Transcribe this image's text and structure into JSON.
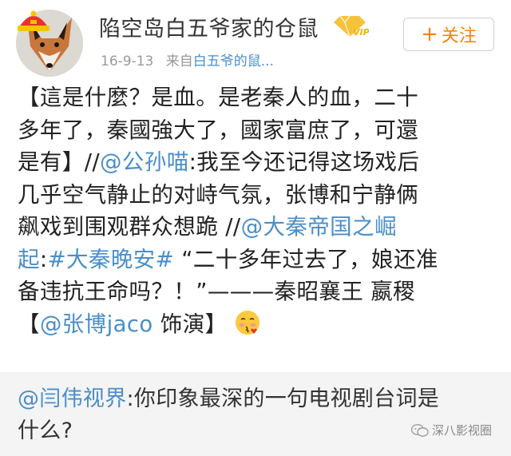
{
  "header": {
    "user_name": "陷空岛白五爷家的仓鼠",
    "vip_badge": "VIP",
    "date": "16-9-13",
    "source_prefix": "来自",
    "source_name": "白五爷的鼠...",
    "follow_label": "关注",
    "follow_plus": "+"
  },
  "post": {
    "line1": "【這是什麼？是血。是老秦人的血，二十",
    "line2": "多年了，秦國強大了，國家富庶了，可還",
    "line3_a": "是有】//",
    "line3_mention": "@公孙喵",
    "line3_b": ":我至今还记得这场戏后",
    "line4": "几乎空气静止的对峙气氛，张博和宁静俩",
    "line5_a": "飙戏到围观群众想跪 //",
    "line5_mention": "@大秦帝国之崛",
    "line6_mention": "起",
    "line6_b": ":",
    "line6_topic": "#大秦晚安#",
    "line6_c": " “二十多年过去了，娘还准",
    "line7": "备违抗王命吗？！”———秦昭襄王 嬴稷",
    "line8_a": "【",
    "line8_mention": "@张博jaco",
    "line8_b": " 饰演】"
  },
  "retweet": {
    "mention": "@闫伟视界",
    "text_a": ":你印象最深的一句电视剧台词是",
    "text_b": "什么?",
    "watermark": "深八影视圈"
  },
  "colors": {
    "link": "#4a8ec9",
    "follow": "#ff8200",
    "meta": "#999999",
    "retweet_bg": "#f4f4f4"
  }
}
